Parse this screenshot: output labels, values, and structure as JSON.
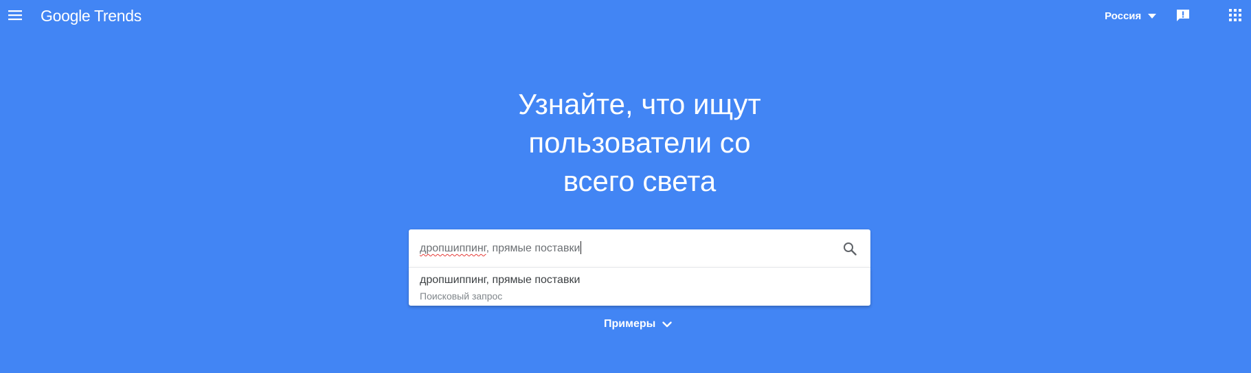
{
  "header": {
    "logo_text": "Google Trends",
    "country_label": "Россия",
    "icons": {
      "menu": "menu-icon",
      "country_dropdown": "caret-down-icon",
      "feedback": "feedback-icon",
      "apps": "apps-grid-icon"
    }
  },
  "hero": {
    "line1": "Узнайте, что ищут",
    "line2": "пользователи со",
    "line3": "всего света"
  },
  "search": {
    "misspelled_part": "дропшиппинг",
    "rest_of_value": ", прямые поставки",
    "icon": "search-icon"
  },
  "suggestions": [
    {
      "title": "дропшиппинг, прямые поставки",
      "subtitle": "Поисковый запрос"
    }
  ],
  "examples": {
    "label": "Примеры",
    "icon": "chevron-down-icon"
  },
  "colors": {
    "background": "#4285f4",
    "surface": "#ffffff",
    "text_dark": "#3c4043",
    "text_muted": "#80868b",
    "spellcheck": "#e53935"
  }
}
